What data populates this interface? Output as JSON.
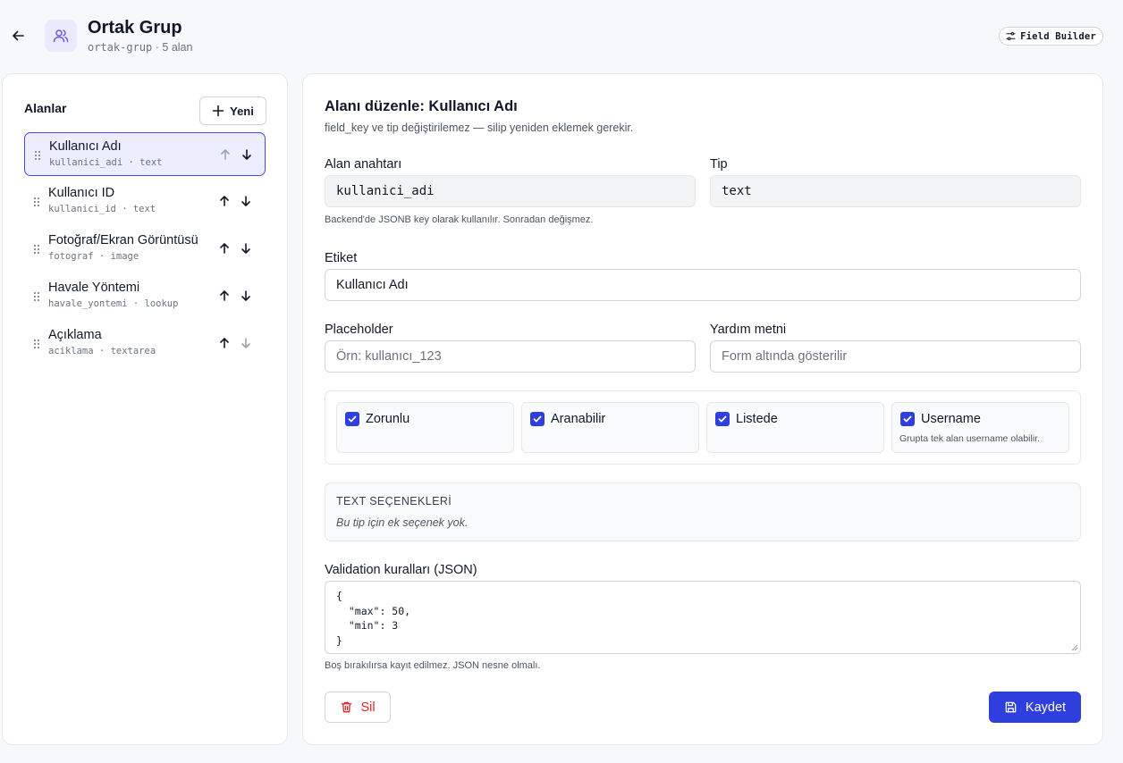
{
  "header": {
    "title": "Ortak Grup",
    "slug": "ortak-grup",
    "separator": "·",
    "count": "5 alan",
    "field_builder_label": "Field Builder"
  },
  "left": {
    "title": "Alanlar",
    "new_label": "Yeni",
    "fields": [
      {
        "label": "Kullanıcı Adı",
        "key": "kullanici_adi",
        "type": "text"
      },
      {
        "label": "Kullanıcı ID",
        "key": "kullanici_id",
        "type": "text"
      },
      {
        "label": "Fotoğraf/Ekran Görüntüsü",
        "key": "fotograf",
        "type": "image"
      },
      {
        "label": "Havale Yöntemi",
        "key": "havale_yontemi",
        "type": "lookup"
      },
      {
        "label": "Açıklama",
        "key": "aciklama",
        "type": "textarea"
      }
    ],
    "meta_sep": "·"
  },
  "editor": {
    "title": "Alanı düzenle: Kullanıcı Adı",
    "subtitle": "field_key ve tip değiştirilemez — silip yeniden eklemek gerekir.",
    "key_label": "Alan anahtarı",
    "key_value": "kullanici_adi",
    "type_label": "Tip",
    "type_value": "text",
    "key_hint": "Backend'de JSONB key olarak kullanılır. Sonradan değişmez.",
    "label_label": "Etiket",
    "label_value": "Kullanıcı Adı",
    "placeholder_label": "Placeholder",
    "placeholder_placeholder": "Örn: kullanıcı_123",
    "help_label": "Yardım metni",
    "help_placeholder": "Form altında gösterilir",
    "flags": [
      {
        "label": "Zorunlu",
        "checked": true,
        "hint": ""
      },
      {
        "label": "Aranabilir",
        "checked": true,
        "hint": ""
      },
      {
        "label": "Listede",
        "checked": true,
        "hint": ""
      },
      {
        "label": "Username",
        "checked": true,
        "hint": "Grupta tek alan username olabilir."
      }
    ],
    "options_title": "TEXT SEÇENEKLERİ",
    "options_empty": "Bu tip için ek seçenek yok.",
    "validation_label": "Validation kuralları (JSON)",
    "validation_value": "{\n  \"max\": 50,\n  \"min\": 3\n}",
    "validation_hint": "Boş bırakılırsa kayıt edilmez. JSON nesne olmalı.",
    "delete_label": "Sil",
    "save_label": "Kaydet"
  },
  "colors": {
    "accent": "#2e3fde",
    "active_bg": "#ecedfd",
    "danger": "#dc2626"
  }
}
